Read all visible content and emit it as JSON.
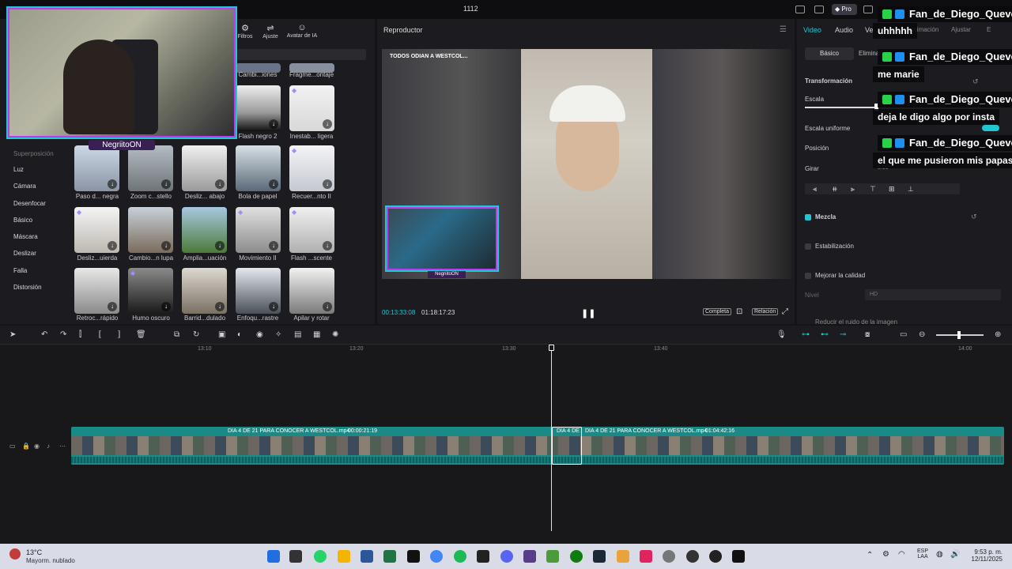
{
  "window": {
    "title": "1112",
    "pro_label": "Pro"
  },
  "left_panel": {
    "tools": [
      {
        "label": "Filtros"
      },
      {
        "label": "Ajuste"
      },
      {
        "label": "Avatar de IA"
      }
    ],
    "categories": [
      "Superposición",
      "Luz",
      "Cámara",
      "Desenfocar",
      "Básico",
      "Máscara",
      "Deslizar",
      "Falla",
      "Distorsión"
    ],
    "effects_row0": [
      "Cambi...iones",
      "Fragme...ontaje"
    ],
    "effects_row1": [
      "Flash negro 2",
      "Inestab... ligera"
    ],
    "effects_row2": [
      "Paso d... negra",
      "Zoom c...stello",
      "Desliz... abajo",
      "Bola de papel",
      "Recuer...nto II"
    ],
    "effects_row3": [
      "Desliz...uierda",
      "Cambio...n lupa",
      "Amplia...uación",
      "Movimiento II",
      "Flash ...scente"
    ],
    "effects_row4": [
      "Retroc...rápido",
      "Humo oscuro",
      "Barrid...dulado",
      "Enfoqu...rastre",
      "Apilar y rotar"
    ]
  },
  "webcam": {
    "name": "NegriitoON"
  },
  "player": {
    "title": "Reproductor",
    "caption": "TODOS ODIAN A WESTCOL...",
    "inner_name": "NegriitoON",
    "time_current": "00:13:33:08",
    "time_total": "01:18:17:23",
    "btn_full": "Completa",
    "btn_ratio": "Relación"
  },
  "properties": {
    "tabs": [
      "Video",
      "Audio",
      "Ve"
    ],
    "tab_extra": [
      "Animación",
      "Ajustar",
      "E"
    ],
    "subtab_basic": "Básico",
    "subtab_remove": "Eliminar",
    "transform_label": "Transformación",
    "scale_label": "Escala",
    "uniform_label": "Escala uniforme",
    "position_label": "Posición",
    "rotate_label": "Girar",
    "rotate_value": "0.00°",
    "blend_label": "Mezcla",
    "stabilize_label": "Estabilización",
    "quality_label": "Mejorar la calidad",
    "level_label": "Nivel",
    "level_value": "HD",
    "noise_label": "Reducir el ruido de la imagen"
  },
  "chat": [
    {
      "user": "Fan_de_Diego_Queve",
      "message": "uhhhhh"
    },
    {
      "user": "Fan_de_Diego_Queve",
      "message": "me marie"
    },
    {
      "user": "Fan_de_Diego_Queve",
      "message": "deja le digo algo por insta"
    },
    {
      "user": "Fan_de_Diego_Queve",
      "message": "el que me pusieron mis papas"
    }
  ],
  "timeline": {
    "ticks": [
      "13:10",
      "13:20",
      "13:30",
      "13:40",
      "14:00"
    ],
    "clip1_label": "DIA 4 DE 21 PARA CONOCER A WESTCOL.mp4",
    "clip1_duration": "00:00:21:19",
    "clip2_short": "DIA 4 DE",
    "clip2_label": "DIA 4 DE 21 PARA CONOCER A WESTCOL.mp4",
    "clip2_duration": "01:04:42:16"
  },
  "taskbar": {
    "temp": "13°C",
    "weather": "Mayorm. nublado",
    "lang1": "ESP",
    "lang2": "LAA",
    "time": "9:53 p. m.",
    "date": "12/11/2025"
  },
  "colors": {
    "accent": "#21c5d0",
    "webcam_border_a": "#1dc9d8",
    "webcam_border_b": "#c33be8",
    "track": "#1a8a86"
  }
}
